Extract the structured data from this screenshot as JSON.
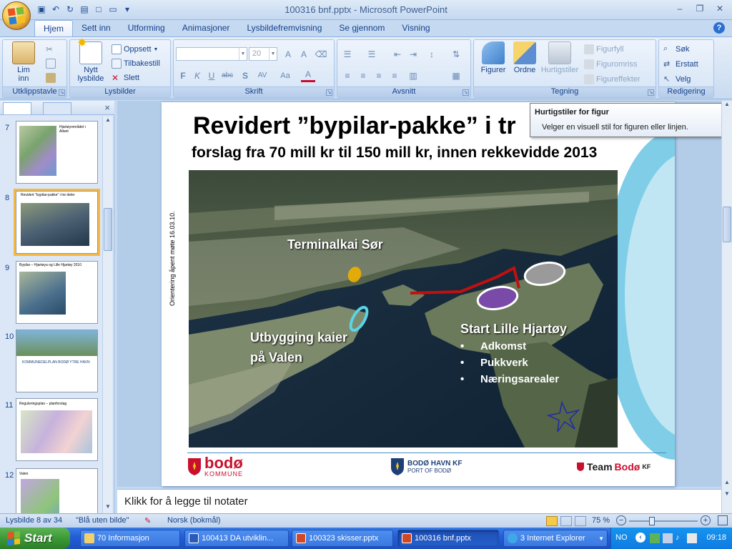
{
  "window": {
    "title": "100316 bnf.pptx - Microsoft PowerPoint"
  },
  "ribbon_tabs": [
    "Hjem",
    "Sett inn",
    "Utforming",
    "Animasjoner",
    "Lysbildefremvisning",
    "Se gjennom",
    "Visning"
  ],
  "ribbon": {
    "clipboard": {
      "label": "Utklippstavle",
      "paste": "Lim\ninn"
    },
    "slides": {
      "label": "Lysbilder",
      "new_slide": "Nytt\nlysbilde",
      "layout": "Oppsett",
      "reset": "Tilbakestill",
      "delete": "Slett"
    },
    "font": {
      "label": "Skrift",
      "size": "20"
    },
    "paragraph": {
      "label": "Avsnitt"
    },
    "drawing": {
      "label": "Tegning",
      "shapes": "Figurer",
      "arrange": "Ordne",
      "quick_styles": "Hurtigstiler",
      "fill": "Figurfyll",
      "outline": "Figuromriss",
      "effects": "Figureffekter"
    },
    "editing": {
      "label": "Redigering",
      "find": "Søk",
      "replace": "Erstatt",
      "select": "Velg"
    }
  },
  "tooltip": {
    "title": "Hurtigstiler for figur",
    "body": "Velger en visuell stil for figuren eller linjen."
  },
  "thumbnails": [
    {
      "num": "7",
      "title": "Hjartøyområdet i Atlant"
    },
    {
      "num": "8",
      "title": "Revidert \"bypilar-pakke\" i tre deler"
    },
    {
      "num": "9",
      "title": "Bypilar – Hjartøya og Lille Hjartøy 2010"
    },
    {
      "num": "10",
      "title": "KOMMUNEDELPLAN BODØ YTRE HAVN"
    },
    {
      "num": "11",
      "title": "Reguleringsplan – planforslag"
    },
    {
      "num": "12",
      "title": "Valen"
    }
  ],
  "slide": {
    "title": "Revidert ”bypilar-pakke” i tr",
    "subtitle": "forslag fra 70 mill kr til 150 mill kr, innen rekkevidde 2013",
    "vertical_note": "Orientering åpent møte 16.03.10.",
    "labels": {
      "terminal": "Terminalkai Sør",
      "valen1": "Utbygging kaier",
      "valen2": "på Valen",
      "start": "Start  Lille Hjartøy"
    },
    "bullets": [
      "Adkomst",
      "Pukkverk",
      "Næringsarealer"
    ],
    "bullet_char": "•",
    "logos": {
      "bodo_name": "bodø",
      "bodo_sub": "KOMMUNE",
      "havn_name": "BODØ HAVN KF",
      "havn_sub": "PORT OF BODØ",
      "team_prefix": "Team",
      "team_bodo": "Bodø",
      "team_suffix": "KF"
    }
  },
  "notes_placeholder": "Klikk for å legge til notater",
  "status": {
    "slide_count": "Lysbilde 8 av 34",
    "theme": "\"Blå uten bilde\"",
    "language": "Norsk (bokmål)",
    "zoom": "75 %"
  },
  "taskbar": {
    "start": "Start",
    "tasks": [
      "70 Informasjon",
      "100413 DA utviklin...",
      "100323 skisser.pptx",
      "100316 bnf.pptx",
      "3 Internet Explorer"
    ],
    "lang": "NO",
    "clock": "09:18"
  },
  "colors": {
    "accent": "#15428b",
    "ribbon": "#dbe7f6",
    "taskbar": "#245ed8",
    "brand_red": "#c8102e"
  }
}
